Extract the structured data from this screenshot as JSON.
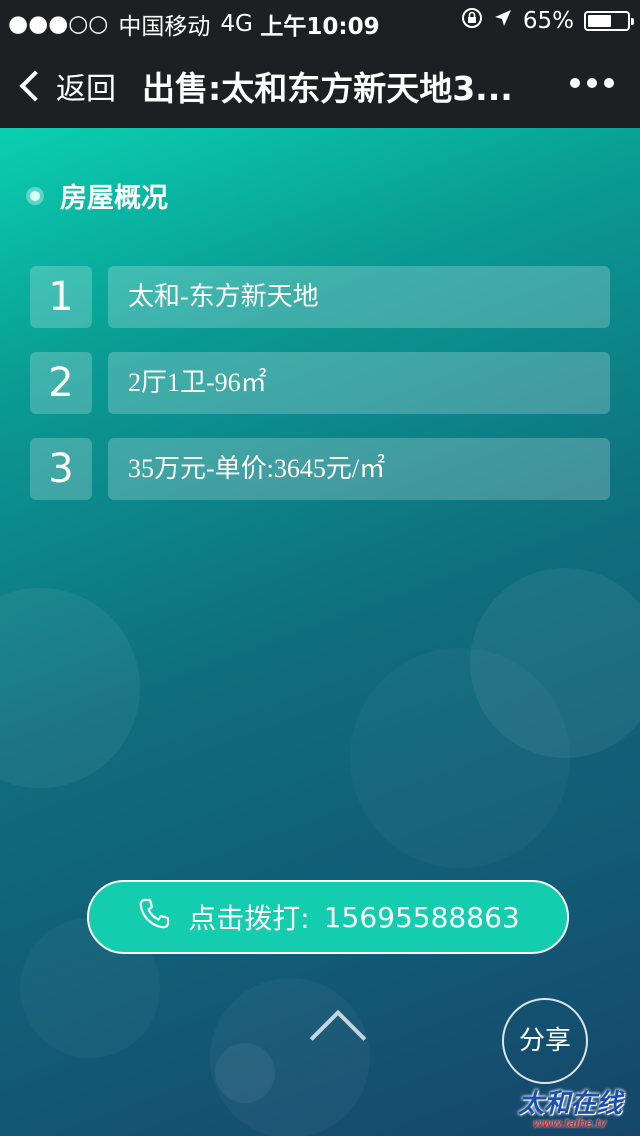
{
  "status_bar": {
    "signal": "●●●○○",
    "carrier": "中国移动",
    "network": "4G",
    "time": "上午10:09",
    "battery": "65%",
    "battery_level": 0.65
  },
  "nav": {
    "back_label": "返回",
    "title": "出售:太和东方新天地3..."
  },
  "section": {
    "title": "房屋概况"
  },
  "rows": [
    {
      "num": "1",
      "text": "太和-东方新天地"
    },
    {
      "num": "2",
      "text": "2厅1卫-96㎡"
    },
    {
      "num": "3",
      "text": "35万元-单价:3645元/㎡"
    }
  ],
  "call": {
    "label": "点击拨打:",
    "phone": "15695588863"
  },
  "share_label": "分享",
  "watermark": {
    "brand": "太和在线",
    "url": "www.taihe.tv"
  }
}
